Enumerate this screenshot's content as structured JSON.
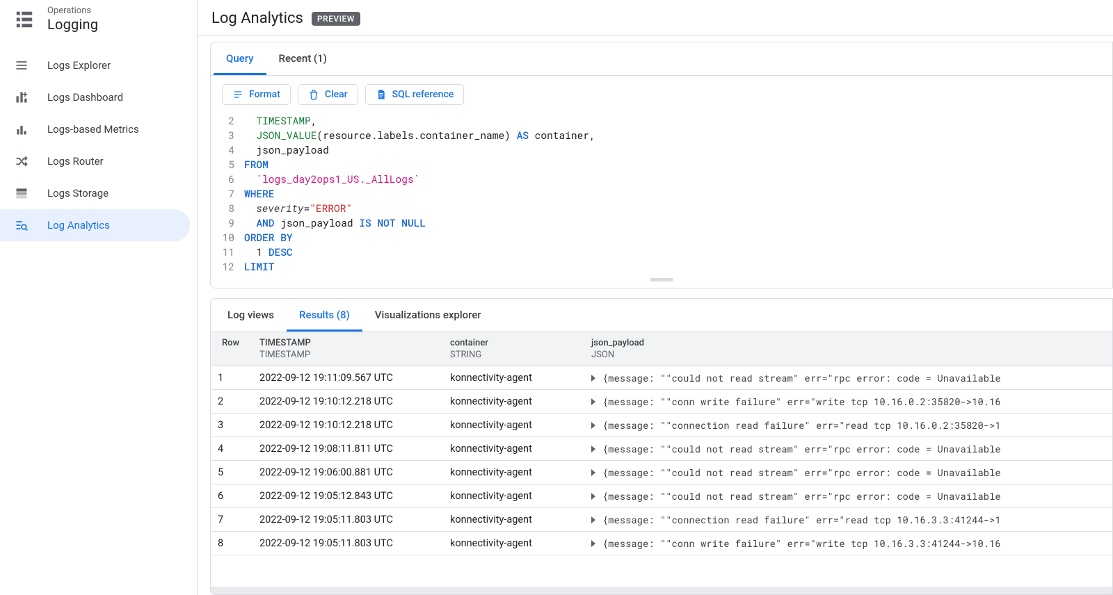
{
  "sidebar": {
    "overline": "Operations",
    "title": "Logging",
    "items": [
      {
        "label": "Logs Explorer",
        "icon": "list"
      },
      {
        "label": "Logs Dashboard",
        "icon": "add-chart"
      },
      {
        "label": "Logs-based Metrics",
        "icon": "bars"
      },
      {
        "label": "Logs Router",
        "icon": "shuffle"
      },
      {
        "label": "Logs Storage",
        "icon": "storage"
      },
      {
        "label": "Log Analytics",
        "icon": "search-list",
        "active": true
      }
    ]
  },
  "page": {
    "title": "Log Analytics",
    "badge": "PREVIEW"
  },
  "query": {
    "tabs": {
      "query": "Query",
      "recent": "Recent (1)"
    },
    "toolbar": {
      "format": "Format",
      "clear": "Clear",
      "sqlref": "SQL reference"
    },
    "lines": [
      {
        "n": 2,
        "html": "&nbsp;&nbsp;<span class='fn'>TIMESTAMP</span>,"
      },
      {
        "n": 3,
        "html": "&nbsp;&nbsp;<span class='fn'>JSON_VALUE</span>(resource.labels.container_name) <span class='kw'>AS</span> container,"
      },
      {
        "n": 4,
        "html": "&nbsp;&nbsp;json_payload"
      },
      {
        "n": 5,
        "html": "<span class='kw'>FROM</span>"
      },
      {
        "n": 6,
        "html": "&nbsp;&nbsp;<span class='tbl'>`logs_day2ops1_US._AllLogs`</span>"
      },
      {
        "n": 7,
        "html": "<span class='kw'>WHERE</span>"
      },
      {
        "n": 8,
        "html": "&nbsp;&nbsp;<span class='id'>severity</span>=<span class='str'>\"ERROR\"</span>"
      },
      {
        "n": 9,
        "html": "&nbsp;&nbsp;<span class='kw'>AND</span> json_payload <span class='kw'>IS NOT NULL</span>"
      },
      {
        "n": 10,
        "html": "<span class='kw'>ORDER BY</span>"
      },
      {
        "n": 11,
        "html": "&nbsp;&nbsp;1 <span class='kw'>DESC</span>"
      },
      {
        "n": 12,
        "html": "<span class='kw'>LIMIT</span>"
      }
    ]
  },
  "results": {
    "tabs": {
      "views": "Log views",
      "results": "Results (8)",
      "viz": "Visualizations explorer"
    },
    "columns": {
      "row": {
        "name": "Row",
        "type": ""
      },
      "timestamp": {
        "name": "TIMESTAMP",
        "type": "TIMESTAMP"
      },
      "container": {
        "name": "container",
        "type": "STRING"
      },
      "payload": {
        "name": "json_payload",
        "type": "JSON"
      }
    },
    "rows": [
      {
        "row": "1",
        "ts": "2022-09-12 19:11:09.567 UTC",
        "container": "konnectivity-agent",
        "payload": "{message: \"\"could not read stream\" err=\"rpc error: code = Unavailable"
      },
      {
        "row": "2",
        "ts": "2022-09-12 19:10:12.218 UTC",
        "container": "konnectivity-agent",
        "payload": "{message: \"\"conn write failure\" err=\"write tcp 10.16.0.2:35820->10.16"
      },
      {
        "row": "3",
        "ts": "2022-09-12 19:10:12.218 UTC",
        "container": "konnectivity-agent",
        "payload": "{message: \"\"connection read failure\" err=\"read tcp 10.16.0.2:35820->1"
      },
      {
        "row": "4",
        "ts": "2022-09-12 19:08:11.811 UTC",
        "container": "konnectivity-agent",
        "payload": "{message: \"\"could not read stream\" err=\"rpc error: code = Unavailable"
      },
      {
        "row": "5",
        "ts": "2022-09-12 19:06:00.881 UTC",
        "container": "konnectivity-agent",
        "payload": "{message: \"\"could not read stream\" err=\"rpc error: code = Unavailable"
      },
      {
        "row": "6",
        "ts": "2022-09-12 19:05:12.843 UTC",
        "container": "konnectivity-agent",
        "payload": "{message: \"\"could not read stream\" err=\"rpc error: code = Unavailable"
      },
      {
        "row": "7",
        "ts": "2022-09-12 19:05:11.803 UTC",
        "container": "konnectivity-agent",
        "payload": "{message: \"\"connection read failure\" err=\"read tcp 10.16.3.3:41244->1"
      },
      {
        "row": "8",
        "ts": "2022-09-12 19:05:11.803 UTC",
        "container": "konnectivity-agent",
        "payload": "{message: \"\"conn write failure\" err=\"write tcp 10.16.3.3:41244->10.16"
      }
    ]
  }
}
